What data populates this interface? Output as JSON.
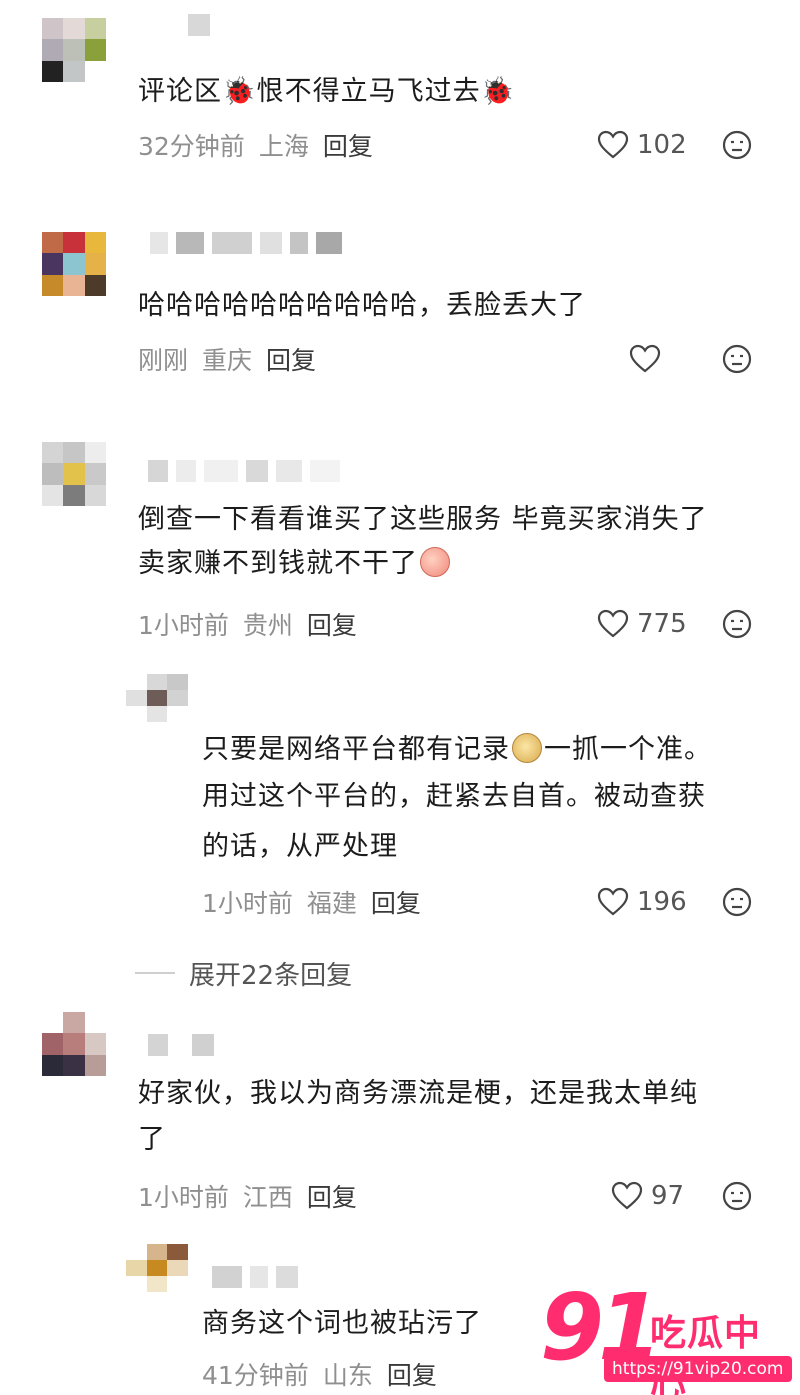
{
  "comments": [
    {
      "text": "评论区🐞恨不得立马飞过去🐞",
      "time": "32分钟前",
      "location": "上海",
      "reply": "回复",
      "likes": "102"
    },
    {
      "text": "哈哈哈哈哈哈哈哈哈哈，丢脸丢大了",
      "time": "刚刚",
      "location": "重庆",
      "reply": "回复",
      "likes": ""
    },
    {
      "text_line1": "倒查一下看看谁买了这些服务 毕竟买家消失了",
      "text_line2": "卖家赚不到钱就不干了",
      "time": "1小时前",
      "location": "贵州",
      "reply": "回复",
      "likes": "775"
    },
    {
      "text_line1a": "只要是网络平台都有记录",
      "text_line1b": "一抓一个准。",
      "text_line2": "用过这个平台的，赶紧去自首。被动查获",
      "text_line3": "的话，从严处理",
      "time": "1小时前",
      "location": "福建",
      "reply": "回复",
      "likes": "196"
    },
    {
      "text_line1": "好家伙，我以为商务漂流是梗，还是我太单纯",
      "text_line2": "了",
      "time": "1小时前",
      "location": "江西",
      "reply": "回复",
      "likes": "97"
    },
    {
      "text": "商务这个词也被玷污了",
      "time": "41分钟前",
      "location": "山东",
      "reply": "回复"
    }
  ],
  "expand_replies": "展开22条回复",
  "watermark": {
    "number": "91",
    "brand": "吃瓜中心",
    "url": "https://91vip20.com"
  },
  "colors": {
    "accent": "#ff2d6f",
    "meta_gray": "#8f8f8f"
  },
  "icons": [
    "heart-icon",
    "dislike-face-icon",
    "ladybug-emoji",
    "peach-emoji",
    "meerkat-emoji"
  ]
}
